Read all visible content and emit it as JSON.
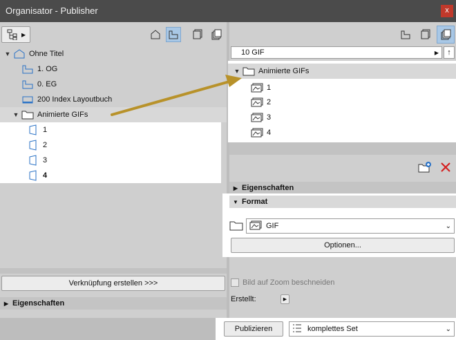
{
  "window": {
    "title": "Organisator - Publisher",
    "close_label": "x"
  },
  "left": {
    "tree": [
      {
        "label": "Ohne Titel",
        "icon": "project-icon"
      },
      {
        "label": "1. OG",
        "icon": "story-icon"
      },
      {
        "label": "0. EG",
        "icon": "story-icon"
      },
      {
        "label": "200 Index Layoutbuch",
        "icon": "layoutbook-icon"
      },
      {
        "label": "Animierte GIFs",
        "icon": "folder-icon"
      },
      {
        "label": "1",
        "icon": "view-icon"
      },
      {
        "label": "2",
        "icon": "view-icon"
      },
      {
        "label": "3",
        "icon": "view-icon"
      },
      {
        "label": "4",
        "icon": "view-icon"
      }
    ],
    "link_button": "Verknüpfung erstellen >>>",
    "properties_label": "Eigenschaften"
  },
  "right": {
    "set_name": "10 GIF",
    "tree": [
      {
        "label": "Animierte GIFs",
        "icon": "folder-icon"
      },
      {
        "label": "1",
        "icon": "gif-icon"
      },
      {
        "label": "2",
        "icon": "gif-icon"
      },
      {
        "label": "3",
        "icon": "gif-icon"
      },
      {
        "label": "4",
        "icon": "gif-icon"
      }
    ],
    "properties_label": "Eigenschaften",
    "format_label": "Format",
    "format_value": "GIF",
    "options_button": "Optionen...",
    "crop_label": "Bild auf Zoom beschneiden",
    "created_label": "Erstellt:"
  },
  "bottom": {
    "publish_button": "Publizieren",
    "set_select": "komplettes Set"
  },
  "colors": {
    "selected_tool": "#a9c8e6",
    "arrow": "#b8922a",
    "delete": "#d42020"
  }
}
